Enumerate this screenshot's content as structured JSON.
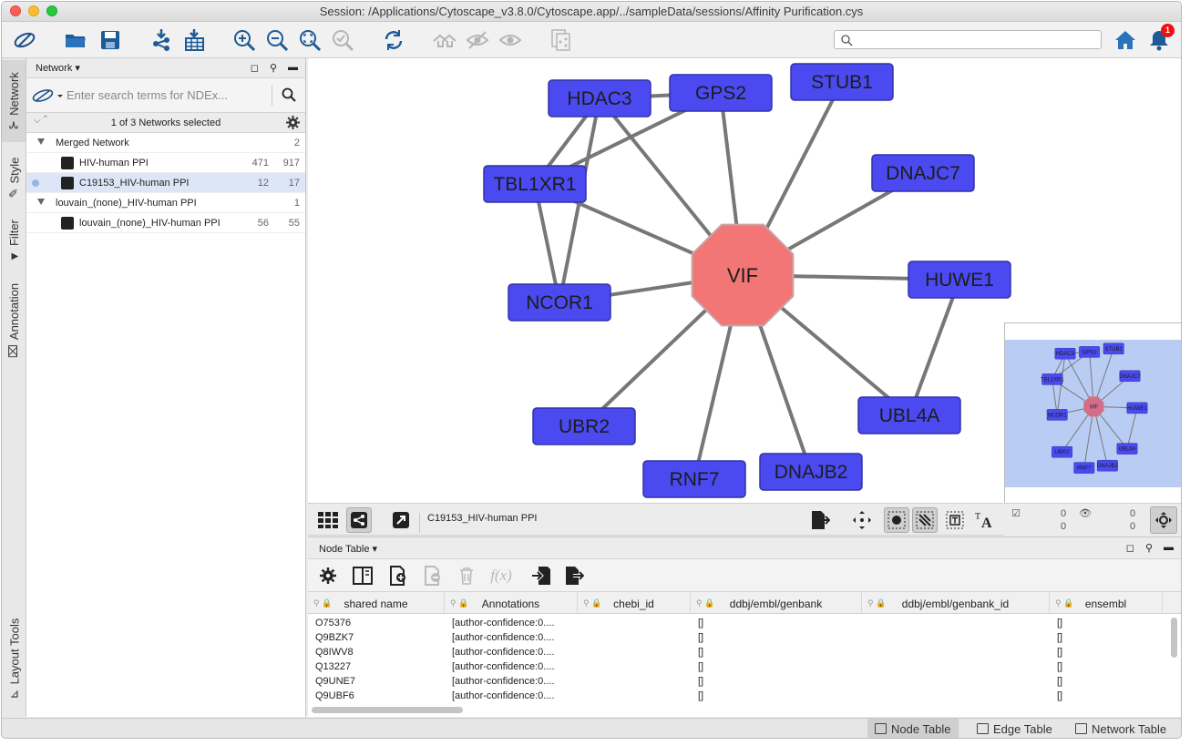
{
  "window": {
    "title": "Session: /Applications/Cytoscape_v3.8.0/Cytoscape.app/../sampleData/sessions/Affinity Purification.cys"
  },
  "toolbar": {
    "search_placeholder": "",
    "notification_count": "1"
  },
  "vtabs": [
    "Network",
    "Style",
    "Filter",
    "Annotation",
    "Layout Tools"
  ],
  "network_panel": {
    "header": "Network",
    "search_placeholder": "Enter search terms for NDEx...",
    "selection_status": "1 of 3 Networks selected",
    "tree": [
      {
        "name": "Merged Network",
        "count": "2",
        "level": "collection"
      },
      {
        "name": "HIV-human PPI",
        "nodes": "471",
        "edges": "917",
        "level": "network"
      },
      {
        "name": "C19153_HIV-human PPI",
        "nodes": "12",
        "edges": "17",
        "level": "network",
        "selected": true
      },
      {
        "name": "louvain_(none)_HIV-human PPI",
        "count": "1",
        "level": "collection"
      },
      {
        "name": "louvain_(none)_HIV-human PPI",
        "nodes": "56",
        "edges": "55",
        "level": "network"
      }
    ]
  },
  "network_view": {
    "hub": "VIF",
    "nodes": [
      "HDAC3",
      "GPS2",
      "STUB1",
      "TBL1XR1",
      "DNAJC7",
      "HUWE1",
      "NCOR1",
      "UBL4A",
      "UBR2",
      "RNF7",
      "DNAJB2"
    ],
    "node_color": "#4a4af0",
    "hub_color": "#f37676",
    "edge_color": "#777777"
  },
  "view_toolbar": {
    "network_title": "C19153_HIV-human PPI"
  },
  "navigator_stats": {
    "a": "0",
    "b": "0",
    "c": "0",
    "d": "0"
  },
  "node_table": {
    "header": "Node Table",
    "columns": [
      "shared name",
      "Annotations",
      "chebi_id",
      "ddbj/embl/genbank",
      "ddbj/embl/genbank_id",
      "ensembl"
    ],
    "rows": [
      [
        "O75376",
        "[author-confidence:0....",
        "",
        "[]",
        "",
        "[]"
      ],
      [
        "Q9BZK7",
        "[author-confidence:0....",
        "",
        "[]",
        "",
        "[]"
      ],
      [
        "Q8IWV8",
        "[author-confidence:0....",
        "",
        "[]",
        "",
        "[]"
      ],
      [
        "Q13227",
        "[author-confidence:0....",
        "",
        "[]",
        "",
        "[]"
      ],
      [
        "Q9UNE7",
        "[author-confidence:0....",
        "",
        "[]",
        "",
        "[]"
      ],
      [
        "Q9UBF6",
        "[author-confidence:0....",
        "",
        "[]",
        "",
        "[]"
      ]
    ]
  },
  "bottom_tabs": [
    "Node Table",
    "Edge Table",
    "Network Table"
  ]
}
